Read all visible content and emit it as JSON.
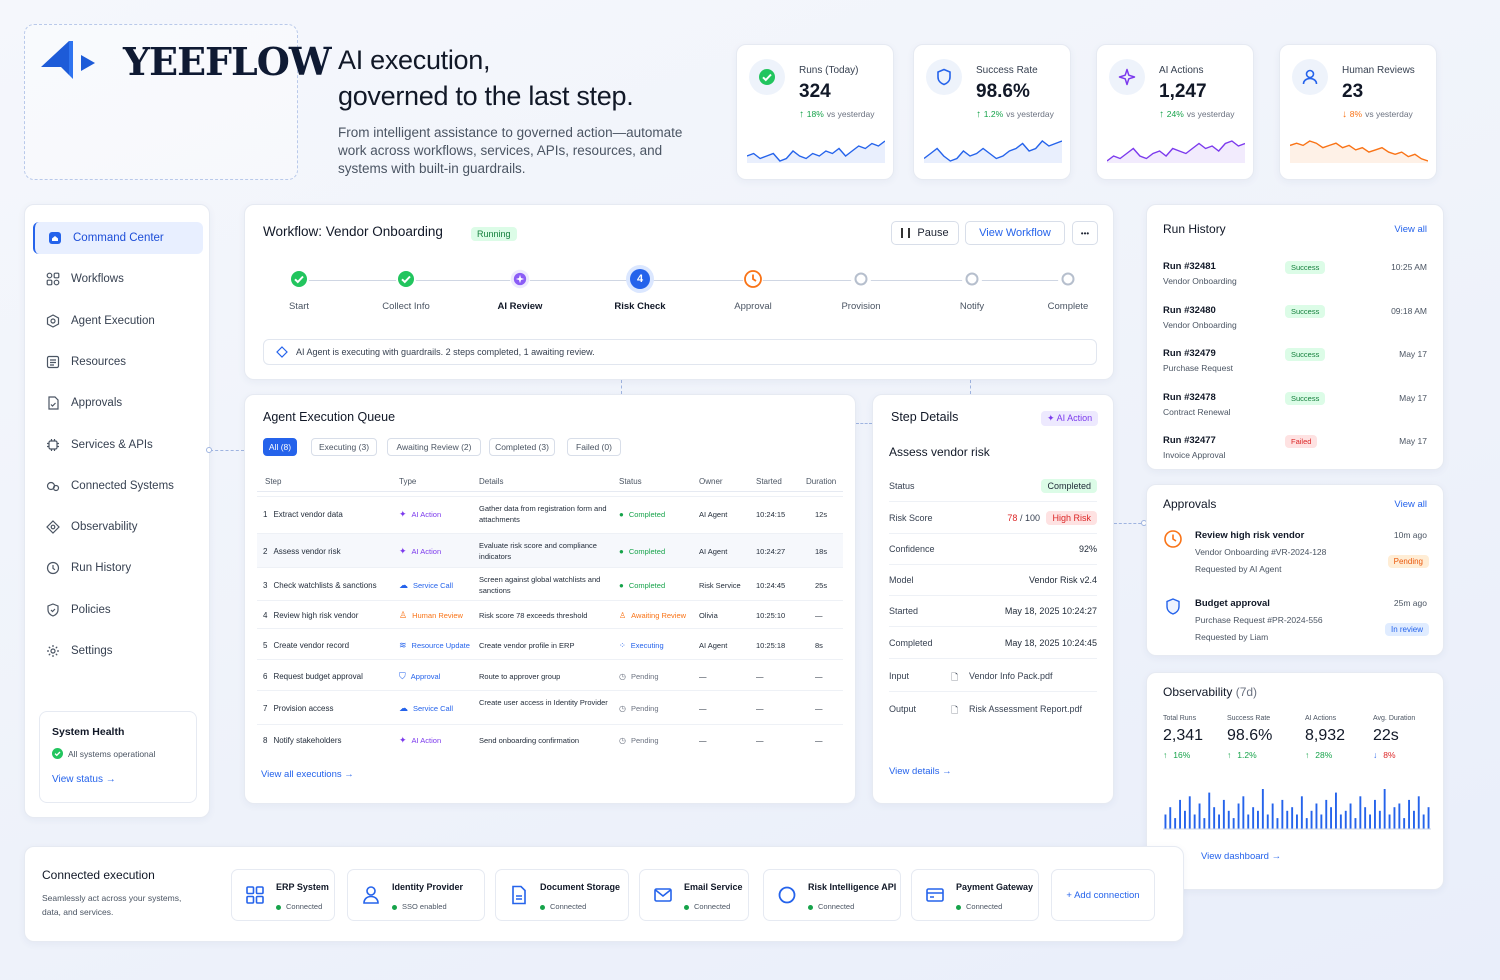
{
  "brand": {
    "name": "YEEFLOW"
  },
  "hero": {
    "title_line1": "AI execution,",
    "title_line2": "governed to the last step.",
    "subtitle": "From intelligent assistance to governed action—automate work across workflows, services, APIs, resources, and systems with built-in guardrails."
  },
  "stats": [
    {
      "label": "Runs (Today)",
      "value": "324",
      "delta": "18%",
      "delta_note": "vs yesterday",
      "direction": "up",
      "icon": "check-circle-icon",
      "color": "#2563eb",
      "trend": [
        6,
        7,
        5,
        6,
        7,
        4,
        5,
        8,
        6,
        5,
        7,
        6,
        8,
        7,
        9,
        6,
        8,
        10,
        9,
        11,
        10,
        12
      ]
    },
    {
      "label": "Success Rate",
      "value": "98.6%",
      "delta": "1.2%",
      "delta_note": "vs yesterday",
      "direction": "up",
      "icon": "shield-icon",
      "color": "#2563eb",
      "trend": [
        5,
        7,
        9,
        6,
        4,
        5,
        8,
        6,
        7,
        9,
        7,
        5,
        6,
        8,
        9,
        11,
        8,
        9,
        12,
        10,
        11,
        12
      ]
    },
    {
      "label": "AI Actions",
      "value": "1,247",
      "delta": "24%",
      "delta_note": "vs yesterday",
      "direction": "up",
      "icon": "sparkle-icon",
      "color": "#7c3aed",
      "trend": [
        4,
        6,
        5,
        7,
        9,
        6,
        5,
        7,
        8,
        6,
        9,
        8,
        7,
        9,
        11,
        9,
        10,
        8,
        11,
        12,
        10,
        11
      ]
    },
    {
      "label": "Human Reviews",
      "value": "23",
      "delta": "8%",
      "delta_note": "vs yesterday",
      "direction": "down",
      "icon": "user-icon",
      "color": "#f97316",
      "trend": [
        10,
        11,
        10,
        12,
        11,
        9,
        10,
        11,
        9,
        10,
        8,
        9,
        7,
        8,
        9,
        7,
        6,
        7,
        5,
        6,
        4,
        3
      ]
    }
  ],
  "sidebar": {
    "items": [
      {
        "label": "Command Center",
        "icon": "home-icon",
        "active": true
      },
      {
        "label": "Workflows",
        "icon": "grid-icon"
      },
      {
        "label": "Agent Execution",
        "icon": "agent-icon"
      },
      {
        "label": "Resources",
        "icon": "resources-icon"
      },
      {
        "label": "Approvals",
        "icon": "document-check-icon"
      },
      {
        "label": "Services & APIs",
        "icon": "services-icon"
      },
      {
        "label": "Connected Systems",
        "icon": "link-icon"
      },
      {
        "label": "Observability",
        "icon": "diamond-icon"
      },
      {
        "label": "Run History",
        "icon": "history-icon"
      },
      {
        "label": "Policies",
        "icon": "policy-shield-icon"
      },
      {
        "label": "Settings",
        "icon": "gear-icon"
      }
    ],
    "health": {
      "title": "System Health",
      "status": "All systems operational",
      "link": "View status"
    }
  },
  "workflow": {
    "title": "Workflow: Vendor Onboarding",
    "status": "Running",
    "pause_label": "Pause",
    "view_label": "View Workflow",
    "more_label": "•••",
    "steps": [
      {
        "label": "Start",
        "state": "done"
      },
      {
        "label": "Collect Info",
        "state": "done"
      },
      {
        "label": "AI Review",
        "state": "ai"
      },
      {
        "label": "Risk Check",
        "state": "current",
        "number": "4"
      },
      {
        "label": "Approval",
        "state": "pending-clock"
      },
      {
        "label": "Provision",
        "state": "todo"
      },
      {
        "label": "Notify",
        "state": "todo"
      },
      {
        "label": "Complete",
        "state": "todo"
      }
    ],
    "info": "AI Agent is executing with guardrails. 2 steps completed, 1 awaiting review."
  },
  "queue": {
    "title": "Agent Execution Queue",
    "tabs": [
      "All (8)",
      "Executing (3)",
      "Awaiting Review (2)",
      "Completed (3)",
      "Failed (0)"
    ],
    "columns": [
      "Step",
      "Type",
      "Details",
      "Status",
      "Owner",
      "Started",
      "Duration"
    ],
    "rows": [
      {
        "num": "1",
        "step": "Extract vendor data",
        "type": "AI Action",
        "type_kind": "ai",
        "details": "Gather data from registration form and attachments",
        "status": "Completed",
        "status_kind": "done",
        "owner": "AI Agent",
        "started": "10:24:15",
        "duration": "12s"
      },
      {
        "num": "2",
        "step": "Assess vendor risk",
        "type": "AI Action",
        "type_kind": "ai",
        "details": "Evaluate risk score and compliance indicators",
        "status": "Completed",
        "status_kind": "done",
        "owner": "AI Agent",
        "started": "10:24:27",
        "duration": "18s"
      },
      {
        "num": "3",
        "step": "Check watchlists & sanctions",
        "type": "Service Call",
        "type_kind": "service",
        "details": "Screen against global watchlists and sanctions",
        "status": "Completed",
        "status_kind": "done",
        "owner": "Risk Service",
        "started": "10:24:45",
        "duration": "25s"
      },
      {
        "num": "4",
        "step": "Review high risk vendor",
        "type": "Human Review",
        "type_kind": "human",
        "details": "Risk score 78 exceeds threshold",
        "status": "Awaiting Review",
        "status_kind": "review",
        "owner": "Olivia",
        "started": "10:25:10",
        "duration": "—"
      },
      {
        "num": "5",
        "step": "Create vendor record",
        "type": "Resource Update",
        "type_kind": "resource",
        "details": "Create vendor profile in ERP",
        "status": "Executing",
        "status_kind": "exec",
        "owner": "AI Agent",
        "started": "10:25:18",
        "duration": "8s"
      },
      {
        "num": "6",
        "step": "Request budget approval",
        "type": "Approval",
        "type_kind": "approval",
        "details": "Route to approver group",
        "status": "Pending",
        "status_kind": "pending",
        "owner": "—",
        "started": "—",
        "duration": "—"
      },
      {
        "num": "7",
        "step": "Provision access",
        "type": "Service Call",
        "type_kind": "service",
        "details": "Create user access in Identity Provider",
        "status": "Pending",
        "status_kind": "pending",
        "owner": "—",
        "started": "—",
        "duration": "—"
      },
      {
        "num": "8",
        "step": "Notify stakeholders",
        "type": "AI Action",
        "type_kind": "ai",
        "details": "Send onboarding confirmation",
        "status": "Pending",
        "status_kind": "pending",
        "owner": "—",
        "started": "—",
        "duration": "—"
      }
    ],
    "view_all": "View all executions"
  },
  "details": {
    "title": "Step Details",
    "badge": "AI Action",
    "subtitle": "Assess vendor risk",
    "status_label": "Status",
    "status_value": "Completed",
    "risk_label": "Risk Score",
    "risk_value": "78",
    "risk_max": "/ 100",
    "risk_badge": "High Risk",
    "confidence_label": "Confidence",
    "confidence_value": "92%",
    "model_label": "Model",
    "model_value": "Vendor Risk v2.4",
    "started_label": "Started",
    "started_value": "May 18, 2025 10:24:27",
    "completed_label": "Completed",
    "completed_value": "May 18, 2025 10:24:45",
    "input_label": "Input",
    "input_value": "Vendor Info Pack.pdf",
    "output_label": "Output",
    "output_value": "Risk Assessment Report.pdf",
    "link": "View details"
  },
  "run_history": {
    "title": "Run History",
    "view_all": "View all",
    "runs": [
      {
        "id": "Run #32481",
        "name": "Vendor Onboarding",
        "status": "Success",
        "time": "10:25 AM"
      },
      {
        "id": "Run #32480",
        "name": "Vendor Onboarding",
        "status": "Success",
        "time": "09:18 AM"
      },
      {
        "id": "Run #32479",
        "name": "Purchase Request",
        "status": "Success",
        "time": "May 17"
      },
      {
        "id": "Run #32478",
        "name": "Contract Renewal",
        "status": "Success",
        "time": "May 17"
      },
      {
        "id": "Run #32477",
        "name": "Invoice Approval",
        "status": "Failed",
        "time": "May 17"
      }
    ]
  },
  "approvals": {
    "title": "Approvals",
    "view_all": "View all",
    "items": [
      {
        "title": "Review high risk vendor",
        "sub": "Vendor Onboarding #VR-2024-128",
        "by": "Requested by AI Agent",
        "time": "10m ago",
        "status": "Pending",
        "icon": "clock-icon"
      },
      {
        "title": "Budget approval",
        "sub": "Purchase Request #PR-2024-556",
        "by": "Requested by Liam",
        "time": "25m ago",
        "status": "In review",
        "icon": "shield-icon"
      }
    ]
  },
  "observability": {
    "title": "Observability",
    "period": "(7d)",
    "metrics": [
      {
        "label": "Total Runs",
        "value": "2,341",
        "delta": "16%",
        "direction": "up"
      },
      {
        "label": "Success Rate",
        "value": "98.6%",
        "delta": "1.2%",
        "direction": "up"
      },
      {
        "label": "AI Actions",
        "value": "8,932",
        "delta": "28%",
        "direction": "up"
      },
      {
        "label": "Avg. Duration",
        "value": "22s",
        "delta": "8%",
        "direction": "down"
      }
    ],
    "bars": [
      4,
      6,
      3,
      8,
      5,
      9,
      4,
      7,
      3,
      10,
      6,
      4,
      8,
      5,
      3,
      7,
      9,
      4,
      6,
      5,
      11,
      4,
      7,
      3,
      8,
      5,
      6,
      4,
      9,
      3,
      5,
      7,
      4,
      8,
      6,
      10,
      4,
      5,
      7,
      3,
      9,
      6,
      4,
      8,
      5,
      11,
      4,
      6,
      7,
      3,
      8,
      5,
      9,
      4,
      6
    ],
    "link": "View dashboard"
  },
  "connected": {
    "title": "Connected execution",
    "subtitle": "Seamlessly act across your systems, data, and services.",
    "systems": [
      {
        "name": "ERP System",
        "status": "Connected",
        "icon": "erp-icon"
      },
      {
        "name": "Identity Provider",
        "status": "SSO enabled",
        "icon": "identity-icon"
      },
      {
        "name": "Document Storage",
        "status": "Connected",
        "icon": "document-icon"
      },
      {
        "name": "Email Service",
        "status": "Connected",
        "icon": "email-icon"
      },
      {
        "name": "Risk Intelligence API",
        "status": "Connected",
        "icon": "risk-api-icon"
      },
      {
        "name": "Payment Gateway",
        "status": "Connected",
        "icon": "payment-icon"
      }
    ],
    "add_label": "+ Add connection"
  }
}
